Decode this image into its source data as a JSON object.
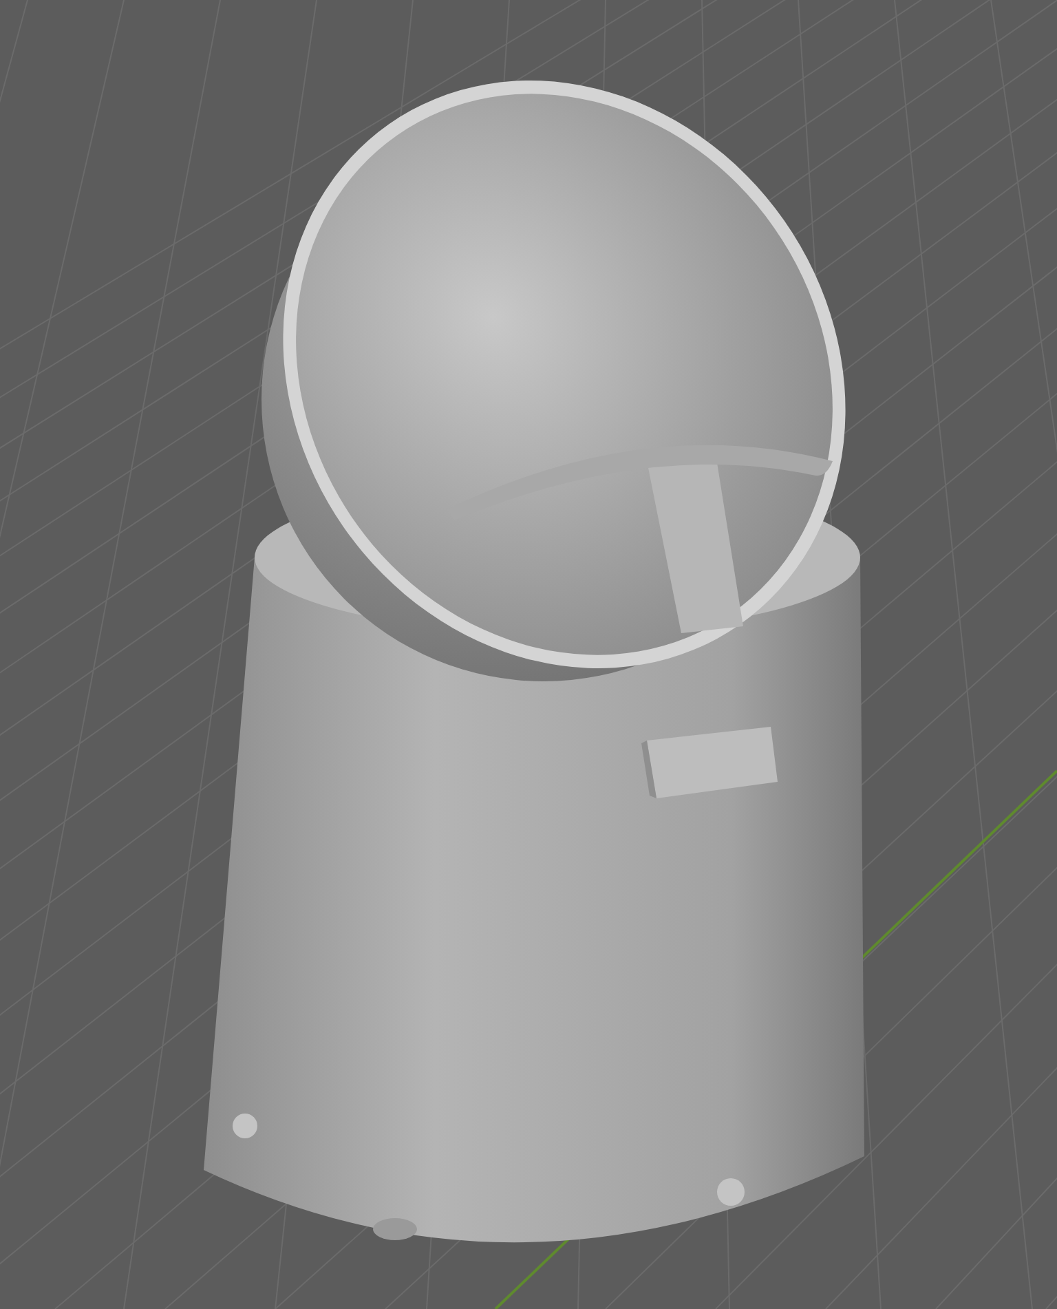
{
  "viewport": {
    "show_grid": true,
    "show_axis_y": true
  }
}
